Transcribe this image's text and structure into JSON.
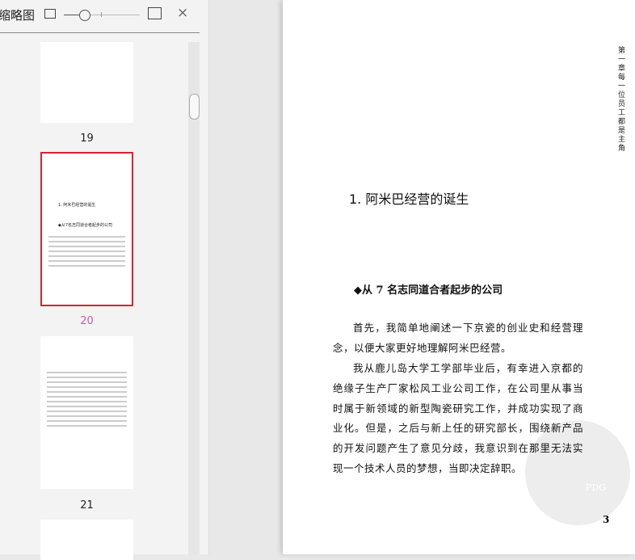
{
  "panel": {
    "title": "缩略图",
    "close_icon": "×",
    "thumbnails": [
      {
        "label": "19"
      },
      {
        "label": "20",
        "selected": true,
        "heading": "1. 阿米巴经营的诞生",
        "sub": "◆从7名志同道合者起步的公司"
      },
      {
        "label": "21"
      }
    ]
  },
  "page": {
    "chapter_header": "第一章 每一位员工都是主角",
    "title": "1. 阿米巴经营的诞生",
    "subtitle": "◆从 7 名志同道合者起步的公司",
    "paragraphs": [
      "首先，我简单地阐述一下京瓷的创业史和经营理念，以便大家更好地理解阿米巴经营。",
      "我从鹿儿岛大学工学部毕业后，有幸进入京都的绝缘子生产厂家松风工业公司工作，在公司里从事当时属于新领域的新型陶瓷研究工作，并成功实现了商业化。但是，之后与新上任的研究部长，围绕新产品的开发问题产生了意见分歧，我意识到在那里无法实现一个技术人员的梦想，当即决定辞职。"
    ],
    "page_number": "3",
    "watermark": "PDG"
  },
  "colors": {
    "selected_border": "#d9232d",
    "selected_label": "#e0559a"
  }
}
